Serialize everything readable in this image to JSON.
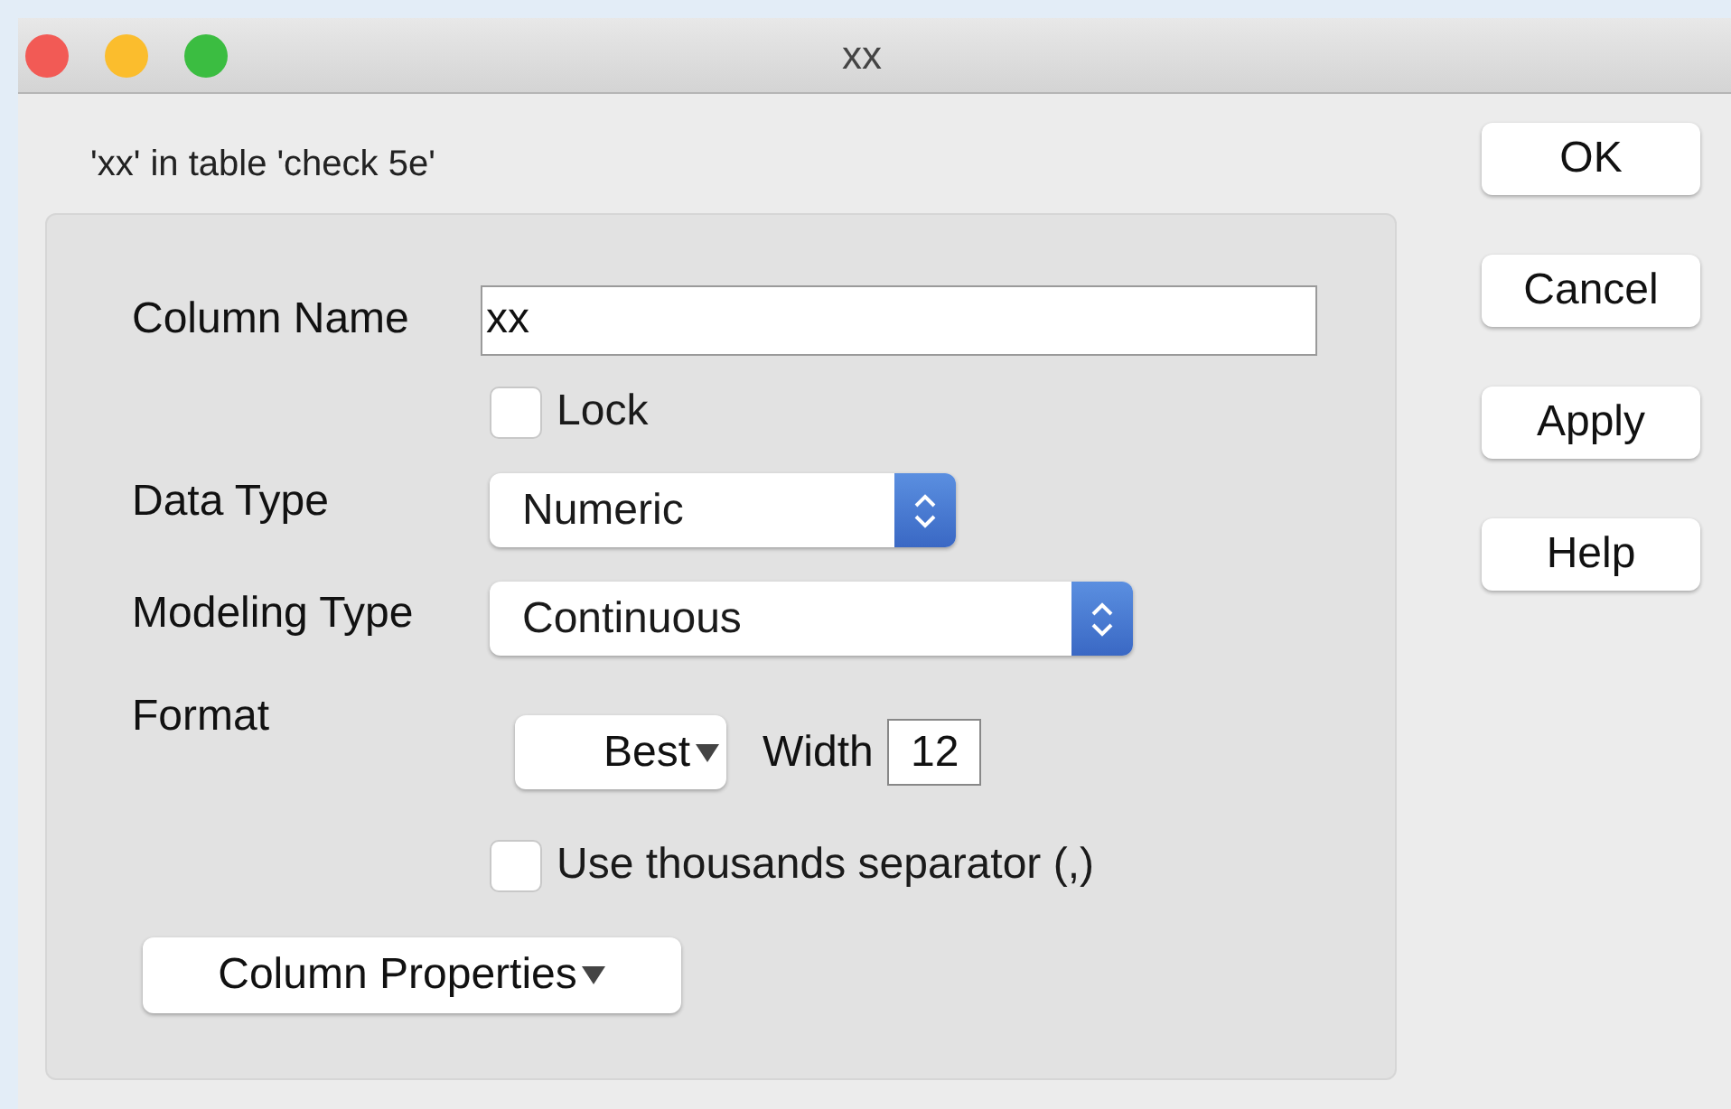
{
  "window": {
    "title": "xx"
  },
  "subtitle": "'xx' in table 'check 5e'",
  "column_name": {
    "label": "Column Name",
    "value": "xx"
  },
  "lock": {
    "label": "Lock",
    "checked": false
  },
  "data_type": {
    "label": "Data Type",
    "value": "Numeric"
  },
  "modeling_type": {
    "label": "Modeling Type",
    "value": "Continuous"
  },
  "format": {
    "label": "Format",
    "value": "Best",
    "width_label": "Width",
    "width_value": "12"
  },
  "thousands_separator": {
    "label": "Use thousands separator (,)",
    "checked": false
  },
  "column_properties": "Column Properties",
  "buttons": [
    "OK",
    "Cancel",
    "Apply",
    "Help"
  ]
}
